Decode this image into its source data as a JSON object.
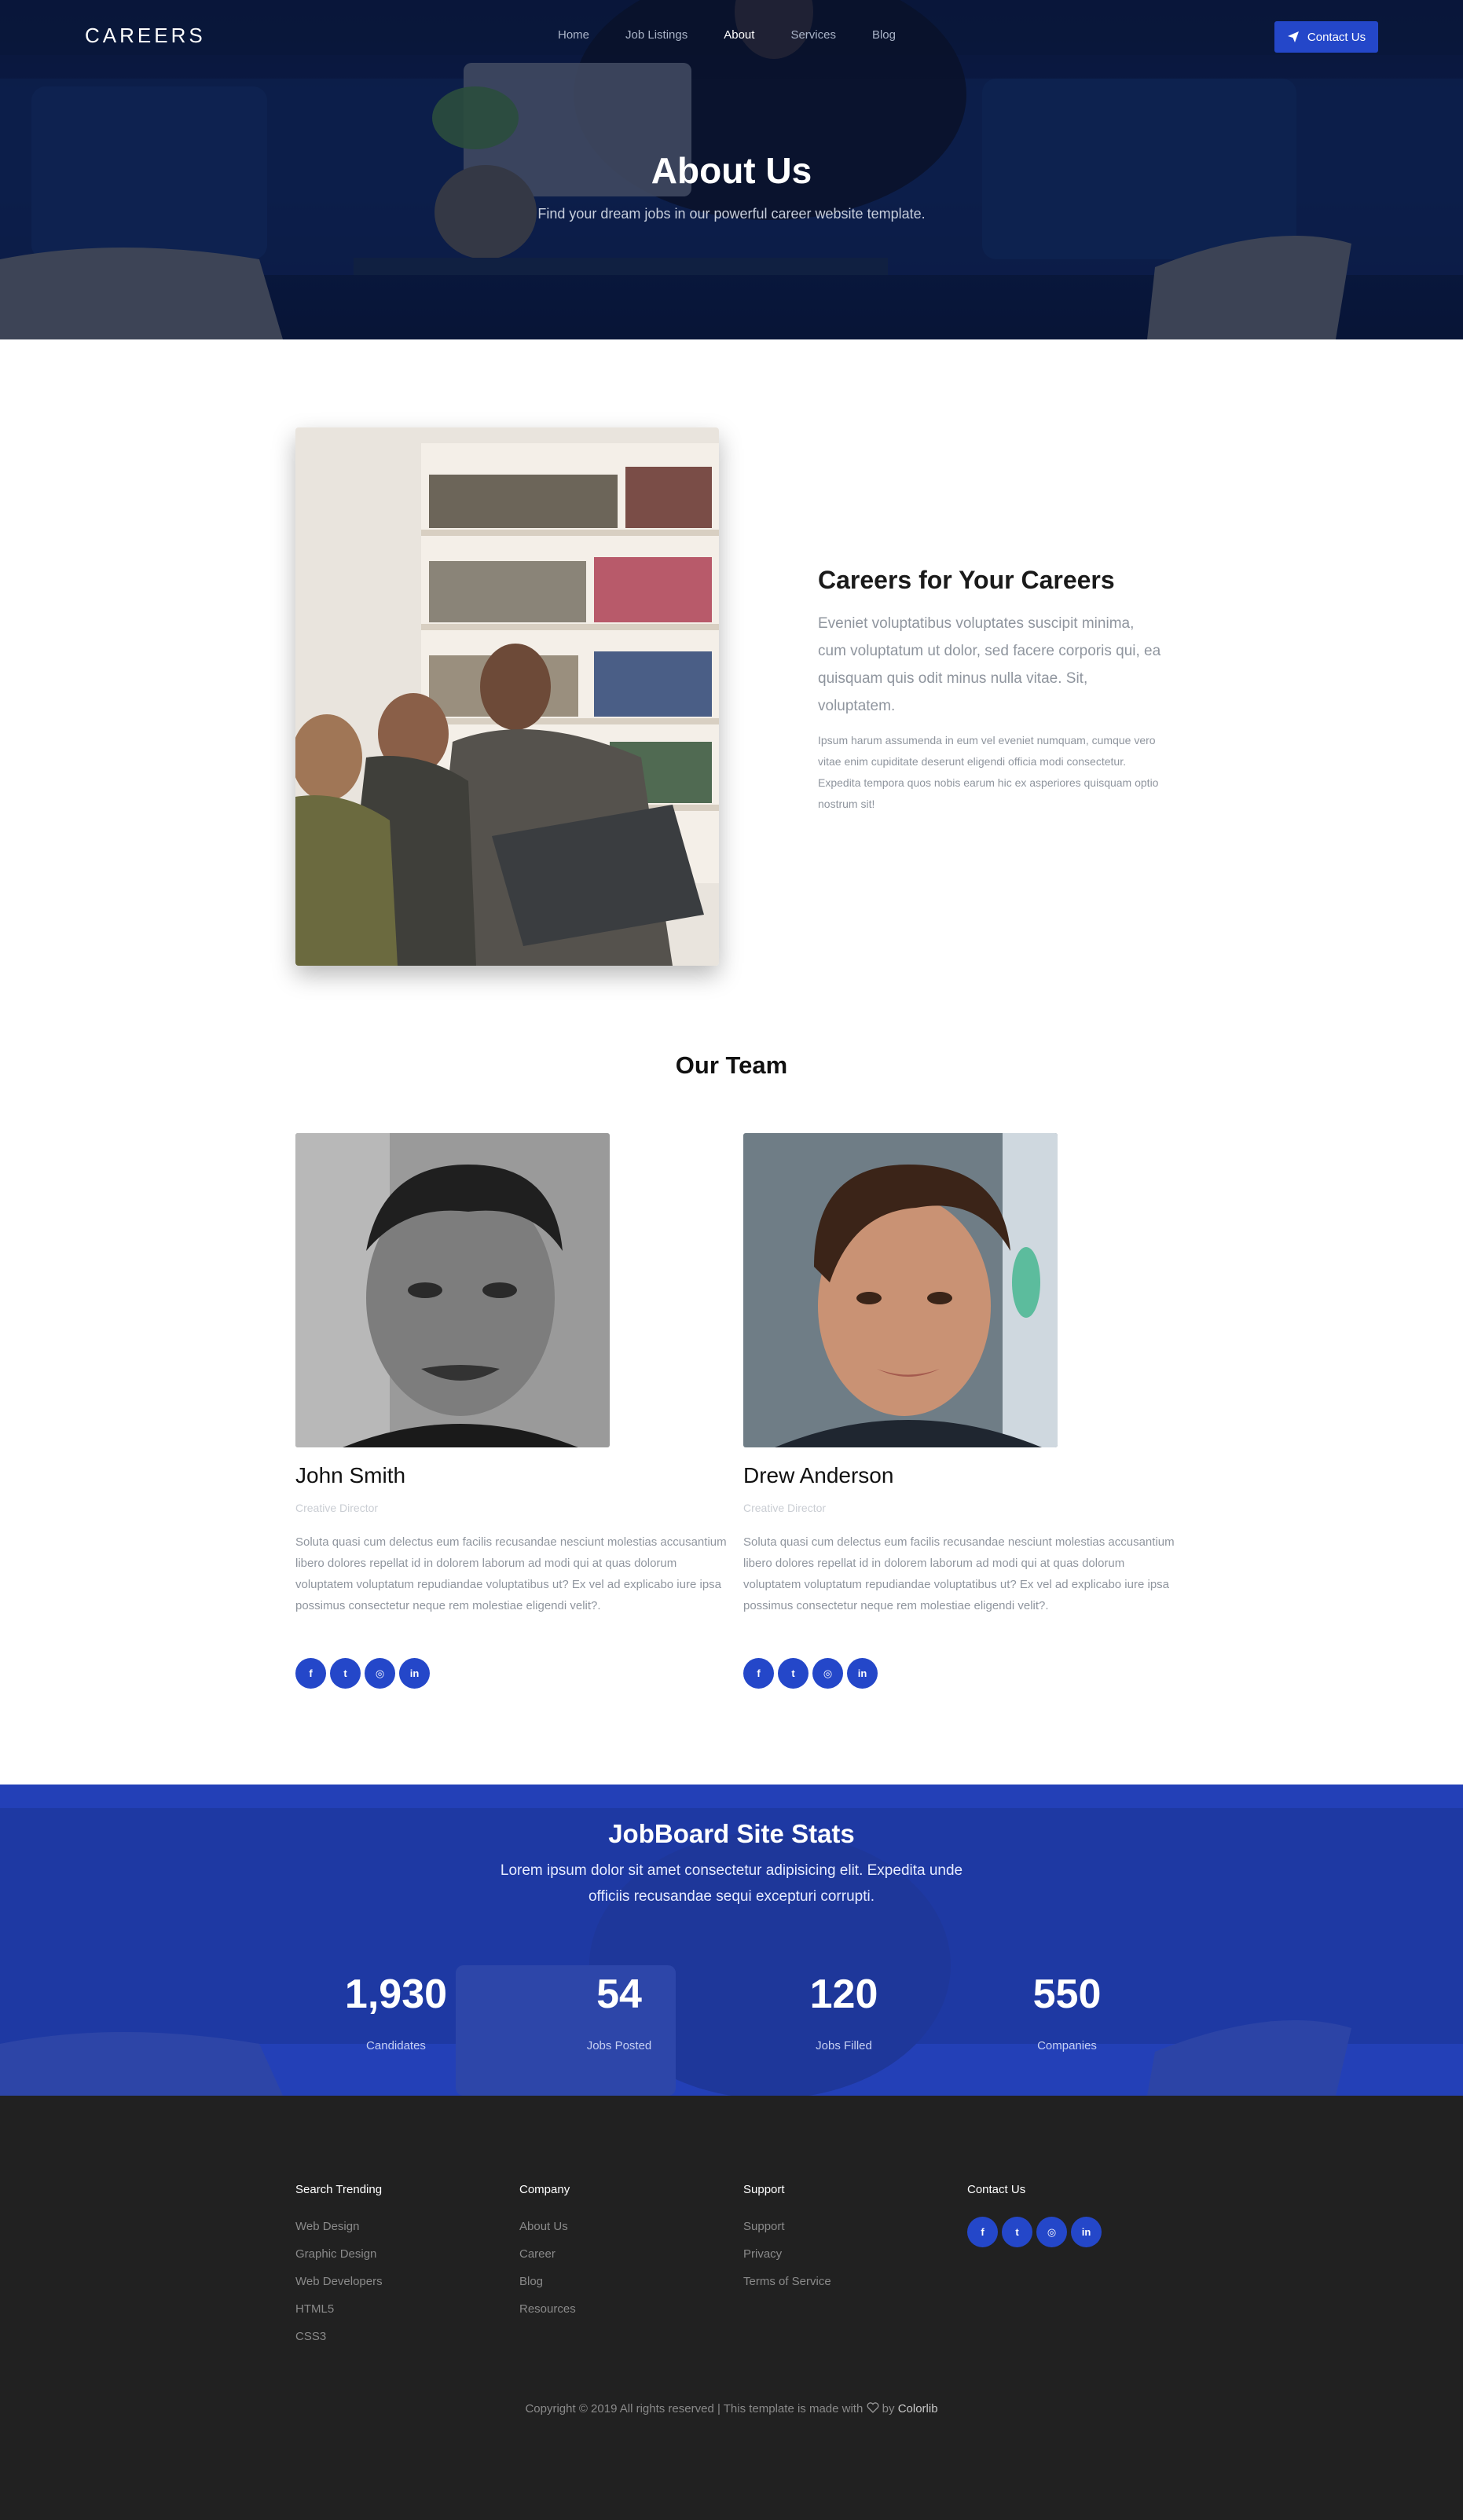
{
  "nav": {
    "logo": "CAREERS",
    "items": [
      {
        "label": "Home"
      },
      {
        "label": "Job Listings"
      },
      {
        "label": "About"
      },
      {
        "label": "Services"
      },
      {
        "label": "Blog"
      }
    ],
    "active": "About",
    "contact_button": "Contact Us",
    "contact_icon": "paper-plane-icon"
  },
  "hero": {
    "title": "About Us",
    "subtitle": "Find your dream jobs in our powerful career website template."
  },
  "about": {
    "title": "Careers for Your Careers",
    "lead": "Eveniet voluptatibus voluptates suscipit minima, cum voluptatum ut dolor, sed facere corporis qui, ea quisquam quis odit minus nulla vitae. Sit, voluptatem.",
    "body": "Ipsum harum assumenda in eum vel eveniet numquam, cumque vero vitae enim cupiditate deserunt eligendi officia modi consectetur. Expedita tempora quos nobis earum hic ex asperiores quisquam optio nostrum sit!"
  },
  "team": {
    "title": "Our Team",
    "members": [
      {
        "name": "John Smith",
        "role": "Creative Director",
        "bio": "Soluta quasi cum delectus eum facilis recusandae nesciunt molestias accusantium libero dolores repellat id in dolorem laborum ad modi qui at quas dolorum voluptatem voluptatum repudiandae voluptatibus ut? Ex vel ad explicabo iure ipsa possimus consectetur neque rem molestiae eligendi velit?."
      },
      {
        "name": "Drew Anderson",
        "role": "Creative Director",
        "bio": "Soluta quasi cum delectus eum facilis recusandae nesciunt molestias accusantium libero dolores repellat id in dolorem laborum ad modi qui at quas dolorum voluptatem voluptatum repudiandae voluptatibus ut? Ex vel ad explicabo iure ipsa possimus consectetur neque rem molestiae eligendi velit?."
      }
    ],
    "social_icons": [
      "facebook-icon",
      "twitter-icon",
      "instagram-icon",
      "linkedin-icon"
    ],
    "social_glyphs": {
      "facebook": "f",
      "twitter": "t",
      "instagram": "◎",
      "linkedin": "in"
    }
  },
  "stats": {
    "title": "JobBoard Site Stats",
    "description": "Lorem ipsum dolor sit amet consectetur adipisicing elit. Expedita unde officiis recusandae sequi excepturi corrupti.",
    "items": [
      {
        "value": "1,930",
        "label": "Candidates"
      },
      {
        "value": "54",
        "label": "Jobs Posted"
      },
      {
        "value": "120",
        "label": "Jobs Filled"
      },
      {
        "value": "550",
        "label": "Companies"
      }
    ]
  },
  "footer": {
    "columns": [
      {
        "title": "Search Trending",
        "links": [
          "Web Design",
          "Graphic Design",
          "Web Developers",
          "HTML5",
          "CSS3"
        ]
      },
      {
        "title": "Company",
        "links": [
          "About Us",
          "Career",
          "Blog",
          "Resources"
        ]
      },
      {
        "title": "Support",
        "links": [
          "Support",
          "Privacy",
          "Terms of Service"
        ]
      },
      {
        "title": "Contact Us",
        "links": []
      }
    ],
    "copyright_prefix": "Copyright © 2019 All rights reserved | This template is made with",
    "copyright_by": "by",
    "copyright_brand": "Colorlib",
    "heart_icon": "heart-icon"
  },
  "colors": {
    "accent": "#2447c9",
    "hero_bg": "#0d1d45",
    "stats_bg": "#2340b7",
    "footer_bg": "#212121"
  }
}
